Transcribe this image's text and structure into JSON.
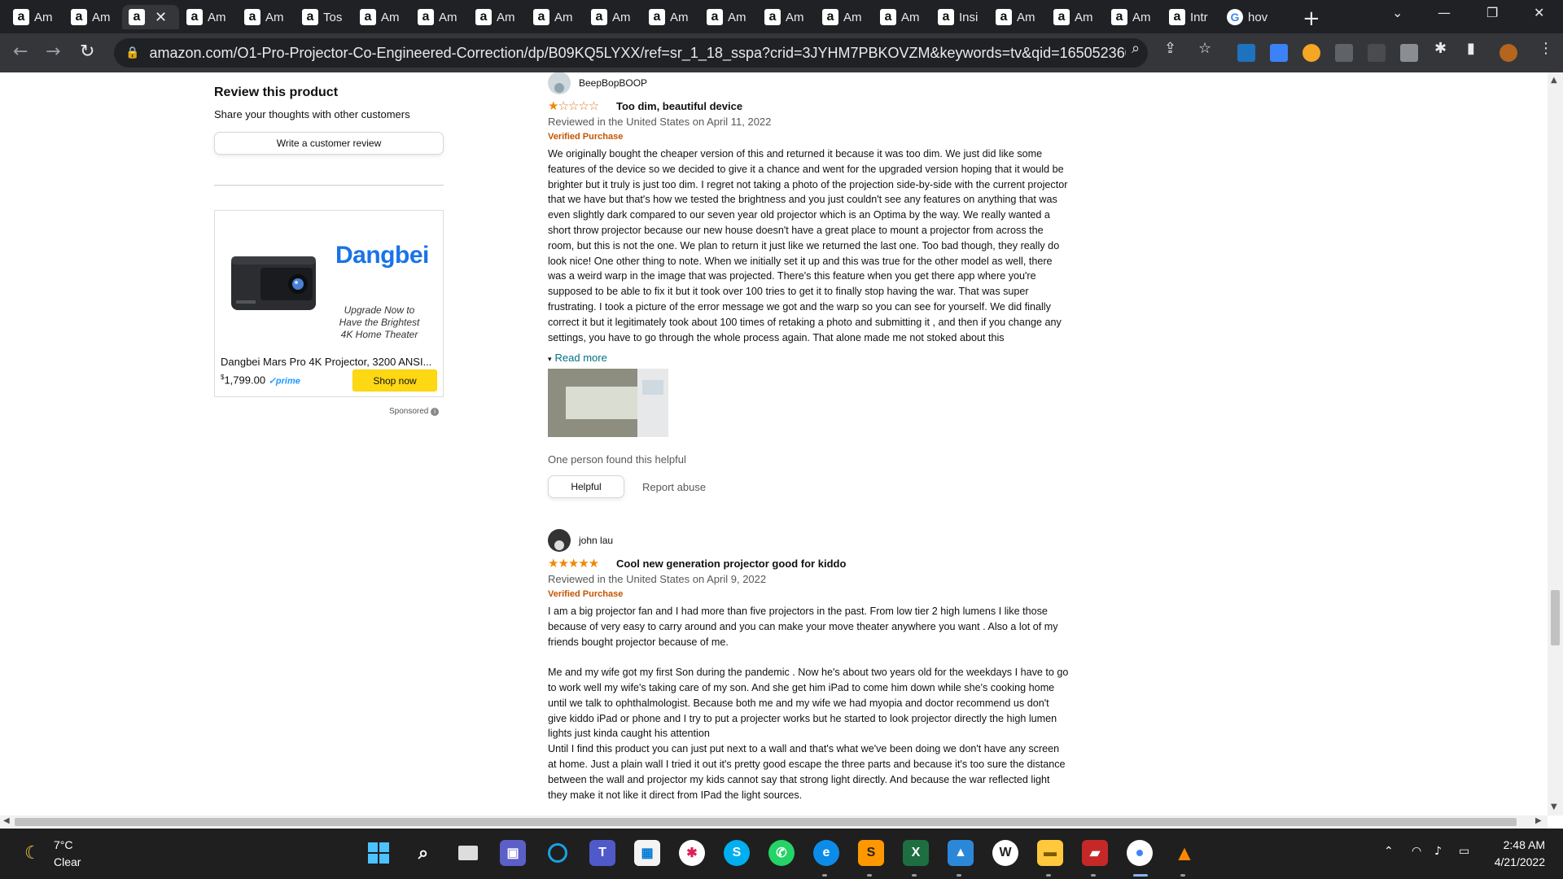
{
  "browser": {
    "tabs": [
      {
        "icon": "amazon-icon",
        "title": "Am"
      },
      {
        "icon": "amazon-icon",
        "title": "Am"
      },
      {
        "icon": "amazon-icon",
        "title": "",
        "active": true
      },
      {
        "icon": "amazon-icon",
        "title": "Am"
      },
      {
        "icon": "amazon-icon",
        "title": "Am"
      },
      {
        "icon": "amazon-icon",
        "title": "Tos"
      },
      {
        "icon": "amazon-icon",
        "title": "Am"
      },
      {
        "icon": "amazon-icon",
        "title": "Am"
      },
      {
        "icon": "amazon-icon",
        "title": "Am"
      },
      {
        "icon": "amazon-icon",
        "title": "Am"
      },
      {
        "icon": "amazon-icon",
        "title": "Am"
      },
      {
        "icon": "amazon-icon",
        "title": "Am"
      },
      {
        "icon": "amazon-icon",
        "title": "Am"
      },
      {
        "icon": "amazon-icon",
        "title": "Am"
      },
      {
        "icon": "amazon-icon",
        "title": "Am"
      },
      {
        "icon": "amazon-icon",
        "title": "Am"
      },
      {
        "icon": "amazon-icon",
        "title": "Insi"
      },
      {
        "icon": "amazon-icon",
        "title": "Am"
      },
      {
        "icon": "amazon-icon",
        "title": "Am"
      },
      {
        "icon": "amazon-icon",
        "title": "Am"
      },
      {
        "icon": "amazon-icon",
        "title": "Intr"
      },
      {
        "icon": "google-icon",
        "title": "hov"
      }
    ],
    "url": "amazon.com/O1-Pro-Projector-Co-Engineered-Correction/dp/B09KQ5LYXX/ref=sr_1_18_sspa?crid=3JYHM7PBKOVZM&keywords=tv&qid=1650523608&s..."
  },
  "sidebar": {
    "heading": "Review this product",
    "subheading": "Share your thoughts with other customers",
    "write_review_label": "Write a customer review"
  },
  "ad": {
    "brand": "Dangbei",
    "tagline_1": "Upgrade Now to",
    "tagline_2": "Have the Brightest",
    "tagline_3": "4K Home Theater",
    "product_title": "Dangbei Mars Pro 4K Projector, 3200 ANSI...",
    "price_symbol": "$",
    "price": "1,799.00",
    "prime_label": "✓prime",
    "shop_now_label": "Shop now",
    "sponsored_label": "Sponsored"
  },
  "reviews": [
    {
      "author": "BeepBopBOOP",
      "rating": 1,
      "stars_on": "★",
      "stars_off": "☆☆☆☆",
      "title": "Too dim, beautiful device",
      "date": "Reviewed in the United States on April 11, 2022",
      "verified": "Verified Purchase",
      "body_paragraphs": [
        "We originally bought the cheaper version of this and returned it because it was too dim. We just did like some features of the device so we decided to give it a chance and went for the upgraded version hoping that it would be brighter but it truly is just too dim. I regret not taking a photo of the projection side-by-side with the current projector that we have but that's how we tested the brightness and you just couldn't see any features on anything that was even slightly dark compared to our seven year old projector which is an Optima by the way. We really wanted a short throw projector because our new house doesn't have a great place to mount a projector from across the room, but this is not the one. We plan to return it just like we returned the last one. Too bad though, they really do look nice! One other thing to note. When we initially set it up and this was true for the other model as well, there was a weird warp in the image that was projected. There's this feature when you get there app where you're supposed to be able to fix it but it took over 100 tries to get it to finally stop having the war. That was super frustrating. I took a picture of the error message we got and the warp so you can see for yourself. We did finally correct it but it legitimately took about 100 times of retaking a photo and submitting it , and then if you change any settings, you have to go through the whole process again. That alone made me not stoked about this"
      ],
      "read_more": "Read more",
      "helpful_count": "One person found this helpful",
      "helpful_label": "Helpful",
      "report_label": "Report abuse"
    },
    {
      "author": "john lau",
      "rating": 5,
      "stars_on": "★★★★★",
      "stars_off": "",
      "title": "Cool new generation projector good for kiddo",
      "date": "Reviewed in the United States on April 9, 2022",
      "verified": "Verified Purchase",
      "body_paragraphs": [
        "I am a big projector fan and I had more than five projectors in the past. From low tier 2 high lumens I like those because of very easy to carry around and you can make your move theater anywhere you want . Also a lot of my friends bought projector because of me.",
        "Me and my wife got my first Son during the pandemic . Now he's about two years old for the weekdays I have to go to work well my wife's taking care of my son. And she get him iPad to come him down while she's cooking home until we talk to ophthalmologist. Because both me and my wife we had myopia and doctor recommend us don't give kiddo iPad or phone and I try to put a projecter works but he started to look projector directly the high lumen lights just kinda caught his attention",
        "Until I find this product you can just put next to a wall and that's what we've been doing we don't have any screen at home. Just a plain wall I tried it out it's pretty good escape the three parts and because it's too sure the distance between the wall and projector my kids cannot say that strong light directly. And because the war reflected light they make it not like it direct from IPad the light sources."
      ]
    }
  ],
  "taskbar": {
    "weather_temp": "7°C",
    "weather_desc": "Clear",
    "clock_time": "2:48 AM",
    "clock_date": "4/21/2022"
  }
}
